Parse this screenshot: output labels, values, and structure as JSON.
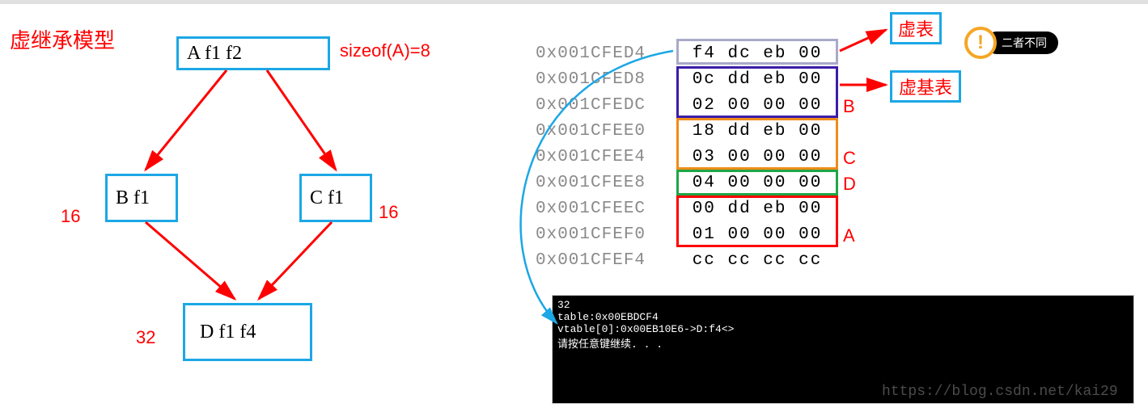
{
  "title": "虚继承模型",
  "classes": {
    "A": {
      "label": "A   f1   f2",
      "sizeText": "sizeof(A)=8"
    },
    "B": {
      "label": "B f1",
      "sizeText": "16"
    },
    "C": {
      "label": "C f1",
      "sizeText": "16"
    },
    "D": {
      "label": "D f1 f4",
      "sizeText": "32"
    }
  },
  "vtable_label": "虚表",
  "vbtable_label": "虚基表",
  "alert_text": "二者不同",
  "alert_icon": "!",
  "memory": [
    {
      "addr": "0x001CFED4",
      "bytes": "f4 dc eb 00"
    },
    {
      "addr": "0x001CFED8",
      "bytes": "0c dd eb 00"
    },
    {
      "addr": "0x001CFEDC",
      "bytes": "02 00 00 00"
    },
    {
      "addr": "0x001CFEE0",
      "bytes": "18 dd eb 00"
    },
    {
      "addr": "0x001CFEE4",
      "bytes": "03 00 00 00"
    },
    {
      "addr": "0x001CFEE8",
      "bytes": "04 00 00 00"
    },
    {
      "addr": "0x001CFEEC",
      "bytes": "00 dd eb 00"
    },
    {
      "addr": "0x001CFEF0",
      "bytes": "01 00 00 00"
    },
    {
      "addr": "0x001CFEF4",
      "bytes": "cc cc cc cc"
    }
  ],
  "mem_labels": {
    "B": "B",
    "C": "C",
    "D": "D",
    "A": "A"
  },
  "console": {
    "line1": "32",
    "line2": "table:0x00EBDCF4",
    "line3": "vtable[0]:0x00EB10E6->D:f4<>",
    "line4": "请按任意键继续. . ."
  },
  "watermark": "https://blog.csdn.net/kai29",
  "colors": {
    "cyan": "#1ca7e5",
    "red": "#ff0000",
    "purple": "#3b1da8",
    "orange": "#f08c1a",
    "green": "#1fa646"
  }
}
